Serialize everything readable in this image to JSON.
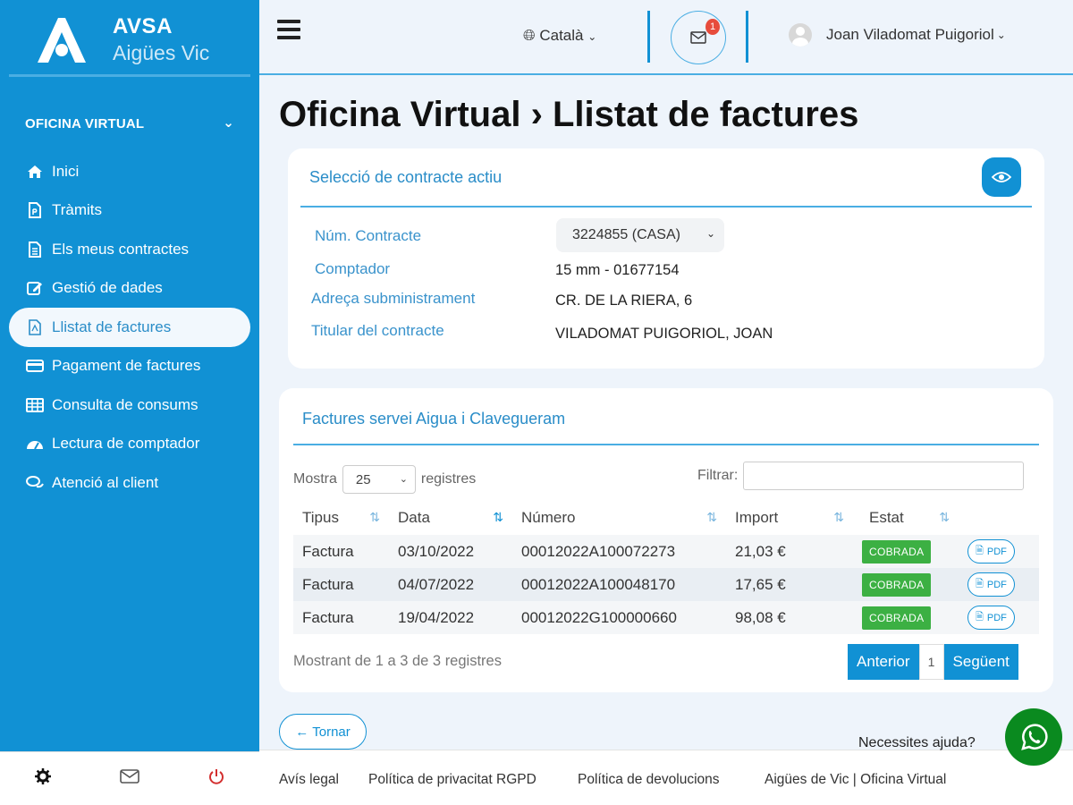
{
  "brand": {
    "name": "AVSA",
    "subtitle": "Aigües Vic"
  },
  "sidebar": {
    "section_title": "OFICINA VIRTUAL",
    "items": [
      {
        "label": "Inici",
        "icon": "home-icon"
      },
      {
        "label": "Tràmits",
        "icon": "document-icon"
      },
      {
        "label": "Els meus contractes",
        "icon": "contract-icon"
      },
      {
        "label": "Gestió de dades",
        "icon": "edit-icon"
      },
      {
        "label": "Llistat de factures",
        "icon": "pdf-file-icon",
        "active": true
      },
      {
        "label": "Pagament de factures",
        "icon": "credit-card-icon"
      },
      {
        "label": "Consulta de consums",
        "icon": "table-icon"
      },
      {
        "label": "Lectura de comptador",
        "icon": "gauge-icon"
      },
      {
        "label": "Atenció al client",
        "icon": "chat-icon"
      }
    ]
  },
  "topbar": {
    "language": "Català",
    "notifications_count": "1",
    "user_name": "Joan Viladomat Puigoriol"
  },
  "page": {
    "title": "Oficina Virtual › Llistat de factures"
  },
  "contract_card": {
    "title": "Selecció de contracte actiu",
    "contract_label": "Núm. Contracte",
    "contract_value": "3224855 (CASA)",
    "meter_label": "Comptador",
    "meter_value": "15 mm - 01677154",
    "address_label": "Adreça subministrament",
    "address_value": "CR. DE LA RIERA, 6",
    "holder_label": "Titular del contracte",
    "holder_value": "VILADOMAT PUIGORIOL, JOAN"
  },
  "invoices_card": {
    "title": "Factures servei Aigua i Clavegueram",
    "show_label": "Mostra",
    "show_value": "25",
    "records_label": "registres",
    "filter_label": "Filtrar:",
    "filter_value": "",
    "columns": [
      "Tipus",
      "Data",
      "Número",
      "Import",
      "Estat"
    ],
    "rows": [
      {
        "type": "Factura",
        "date": "03/10/2022",
        "number": "00012022A100072273",
        "amount": "21,03 €",
        "status": "COBRADA",
        "pdf": "PDF"
      },
      {
        "type": "Factura",
        "date": "04/07/2022",
        "number": "00012022A100048170",
        "amount": "17,65 €",
        "status": "COBRADA",
        "pdf": "PDF"
      },
      {
        "type": "Factura",
        "date": "19/04/2022",
        "number": "00012022G100000660",
        "amount": "98,08 €",
        "status": "COBRADA",
        "pdf": "PDF"
      }
    ],
    "showing_text": "Mostrant de 1 a 3 de 3 registres",
    "prev_label": "Anterior",
    "page_number": "1",
    "next_label": "Següent"
  },
  "back_button": "Tornar",
  "footer": {
    "links": [
      "Avís legal",
      "Política de privacitat RGPD",
      "Política de devolucions",
      "Aigües de Vic | Oficina Virtual"
    ]
  },
  "help_text": "Necessites ajuda?",
  "colors": {
    "primary": "#1191d4",
    "status_paid": "#3cb043",
    "badge": "#e74c3c",
    "whatsapp": "#0a8a1f"
  }
}
